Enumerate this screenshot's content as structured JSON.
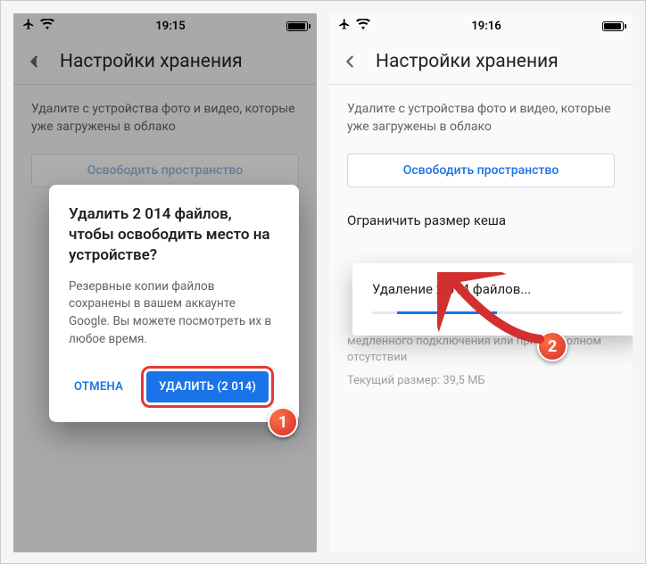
{
  "left": {
    "status": {
      "time": "19:15"
    },
    "header": {
      "title": "Настройки хранения"
    },
    "description": "Удалите с устройства фото и видео, которые уже загружены в облако",
    "freeup_button": "Освободить пространство",
    "dialog": {
      "title": "Удалить 2 014 файлов, чтобы освободить место на устройстве?",
      "body": "Резервные копии файлов сохранены в вашем аккаунте Google. Вы можете посмотреть их в любое время.",
      "cancel": "ОТМЕНА",
      "confirm": "УДАЛИТЬ (2 014)"
    },
    "badge": "1"
  },
  "right": {
    "status": {
      "time": "19:16"
    },
    "header": {
      "title": "Настройки хранения"
    },
    "description": "Удалите с устройства фото и видео, которые уже загружены в облако",
    "freeup_button": "Освободить пространство",
    "cache": {
      "section_title": "Ограничить размер кеша",
      "desc_partial": "медленного подключения или при его полном отсутствии",
      "current": "Текущий размер: 39,5 МБ"
    },
    "toast": {
      "text": "Удаление 2 014 файлов..."
    },
    "badge": "2"
  }
}
